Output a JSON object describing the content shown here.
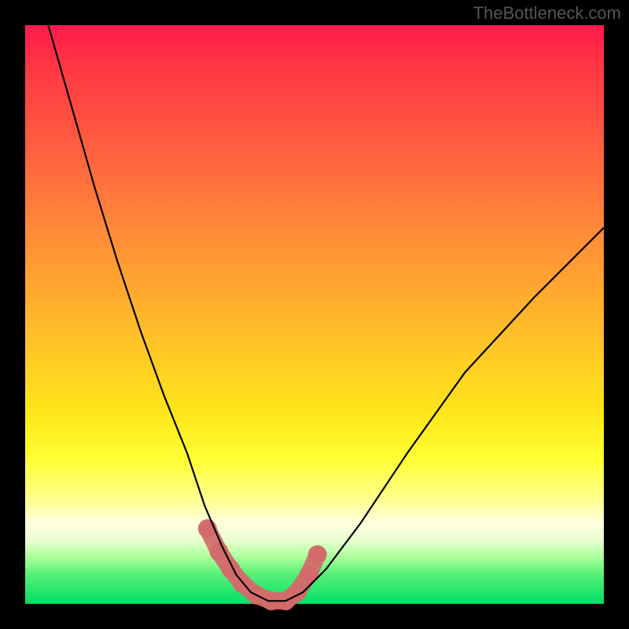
{
  "watermark": "TheBottleneck.com",
  "chart_data": {
    "type": "line",
    "title": "",
    "xlabel": "",
    "ylabel": "",
    "xlim": [
      0,
      100
    ],
    "ylim": [
      0,
      100
    ],
    "series": [
      {
        "name": "bottleneck-curve",
        "x": [
          4,
          8,
          12,
          16,
          20,
          24,
          28,
          31,
          34,
          36.5,
          39,
          42,
          45,
          48,
          52,
          58,
          66,
          76,
          88,
          100
        ],
        "values": [
          100,
          86,
          72,
          59,
          47,
          36,
          26,
          17,
          10,
          5,
          2,
          0.5,
          0.5,
          2,
          6,
          14,
          26,
          40,
          53,
          65
        ]
      },
      {
        "name": "highlight-band",
        "x": [
          31.5,
          33.5,
          35.5,
          37.5,
          40,
          42.5,
          45,
          47,
          49,
          50.5
        ],
        "values": [
          13,
          9,
          6,
          3.5,
          1.5,
          0.5,
          0.5,
          2,
          5,
          8.5
        ]
      }
    ],
    "colors": {
      "curve": "#000000",
      "highlight": "#d46a6a",
      "gradient_top": "#ff1a4d",
      "gradient_mid": "#ffe61a",
      "gradient_bottom": "#00e066",
      "frame": "#000000"
    }
  }
}
